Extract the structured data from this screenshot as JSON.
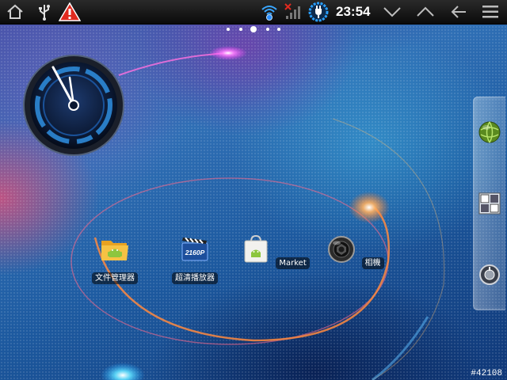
{
  "status_bar": {
    "left_icons": [
      "home-icon",
      "usb-icon",
      "warning-icon"
    ],
    "right_icons": [
      "wifi-icon",
      "signal-icon",
      "battery-charging-icon"
    ],
    "time": "23:54",
    "nav_icons": [
      "chevron-down-icon",
      "chevron-up-icon",
      "back-arrow-icon",
      "menu-icon"
    ],
    "colors": {
      "background": "#111111",
      "warning": "#e02a1f",
      "wifi": "#3aa6ff",
      "battery_ring": "#2aa0ff"
    }
  },
  "pager": {
    "pages": 5,
    "current_index": 2
  },
  "apps": [
    {
      "label": "文件管理器",
      "icon": "folder-android-icon"
    },
    {
      "label": "超清播放器",
      "icon": "video-player-2160p-icon",
      "icon_text": "2160P"
    },
    {
      "label": "Market",
      "icon": "market-bag-icon"
    },
    {
      "label": "相機",
      "icon": "camera-icon"
    }
  ],
  "dock": {
    "buttons": [
      "browser-globe-icon",
      "all-apps-grid-icon",
      "settings-knob-icon"
    ]
  },
  "watermark": "#42108"
}
